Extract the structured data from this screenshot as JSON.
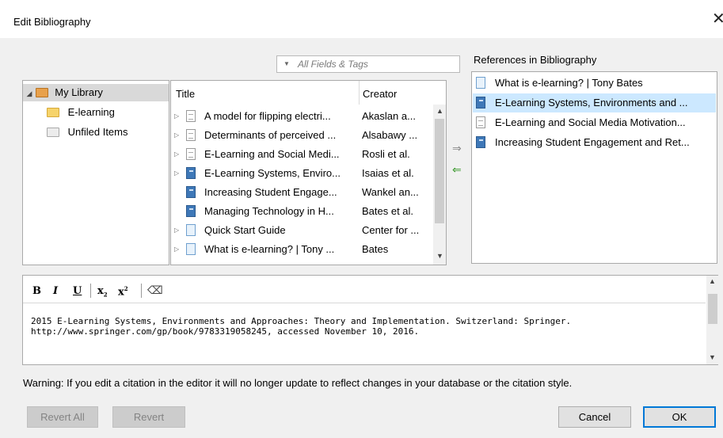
{
  "window": {
    "title": "Edit Bibliography",
    "close_glyph": "✕"
  },
  "filter": {
    "placeholder": "All Fields & Tags",
    "dropdown_glyph": "▼"
  },
  "library": {
    "items": [
      {
        "label": "My Library",
        "icon": "library-folder-icon",
        "expanded": true,
        "selected": true
      },
      {
        "label": "E-learning",
        "icon": "folder-icon"
      },
      {
        "label": "Unfiled Items",
        "icon": "unfiled-folder-icon"
      }
    ]
  },
  "items_table": {
    "columns": {
      "title": "Title",
      "creator": "Creator"
    },
    "rows": [
      {
        "title": "A model for flipping electri...",
        "creator": "Akaslan a...",
        "icon": "document",
        "expandable": true
      },
      {
        "title": "Determinants of perceived ...",
        "creator": "Alsabawy ...",
        "icon": "document",
        "expandable": true
      },
      {
        "title": "E-Learning and Social Medi...",
        "creator": "Rosli et al.",
        "icon": "document",
        "expandable": true
      },
      {
        "title": "E-Learning Systems, Enviro...",
        "creator": "Isaias et al.",
        "icon": "book",
        "expandable": true
      },
      {
        "title": "Increasing Student Engage...",
        "creator": "Wankel an...",
        "icon": "book",
        "expandable": false
      },
      {
        "title": "Managing Technology in H...",
        "creator": "Bates et al.",
        "icon": "book",
        "expandable": false
      },
      {
        "title": "Quick Start Guide",
        "creator": "Center for ...",
        "icon": "web",
        "expandable": true
      },
      {
        "title": "What is e-learning? | Tony ...",
        "creator": "Bates",
        "icon": "web",
        "expandable": true
      }
    ]
  },
  "transfer": {
    "add_glyph": "⇒",
    "remove_glyph": "⇐"
  },
  "bibliography": {
    "label": "References in Bibliography",
    "items": [
      {
        "text": "What is e-learning? | Tony Bates",
        "icon": "web"
      },
      {
        "text": "E-Learning Systems, Environments and ...",
        "icon": "book",
        "selected": true
      },
      {
        "text": "E-Learning and Social Media Motivation...",
        "icon": "document"
      },
      {
        "text": "Increasing Student Engagement and Ret...",
        "icon": "book"
      }
    ]
  },
  "editor": {
    "toolbar": {
      "bold": "B",
      "italic": "I",
      "underline": "U",
      "subscript": "x",
      "superscript": "x",
      "clear": "⌫"
    },
    "content": "2015 E-Learning Systems, Environments and Approaches: Theory and Implementation. Switzerland: Springer.\nhttp://www.springer.com/gp/book/9783319058245, accessed November 10, 2016."
  },
  "warning": "Warning: If you edit a citation in the editor it will no longer update to reflect changes in your database or the citation style.",
  "buttons": {
    "revert_all": "Revert All",
    "revert": "Revert",
    "cancel": "Cancel",
    "ok": "OK"
  }
}
